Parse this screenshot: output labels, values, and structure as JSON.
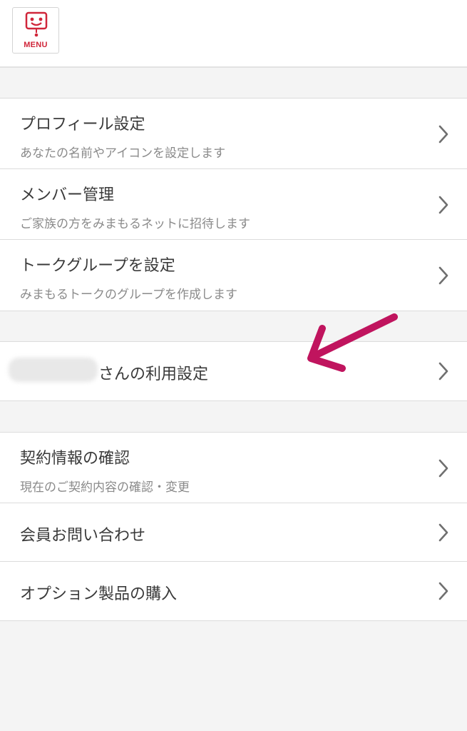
{
  "header": {
    "menu_label": "MENU",
    "menu_icon": "robot-face-icon"
  },
  "settings_group": [
    {
      "title": "プロフィール設定",
      "subtitle": "あなたの名前やアイコンを設定します"
    },
    {
      "title": "メンバー管理",
      "subtitle": "ご家族の方をみまもるネットに招待します"
    },
    {
      "title": "トークグループを設定",
      "subtitle": "みまもるトークのグループを作成します"
    }
  ],
  "user_group": {
    "title": "さんの利用設定"
  },
  "account_group": [
    {
      "title": "契約情報の確認",
      "subtitle": "現在のご契約内容の確認・変更"
    },
    {
      "title": "会員お問い合わせ"
    },
    {
      "title": "オプション製品の購入"
    }
  ],
  "colors": {
    "accent": "#d0263a",
    "annotation_arrow": "#c0145e",
    "chevron": "#6f6f6f"
  }
}
